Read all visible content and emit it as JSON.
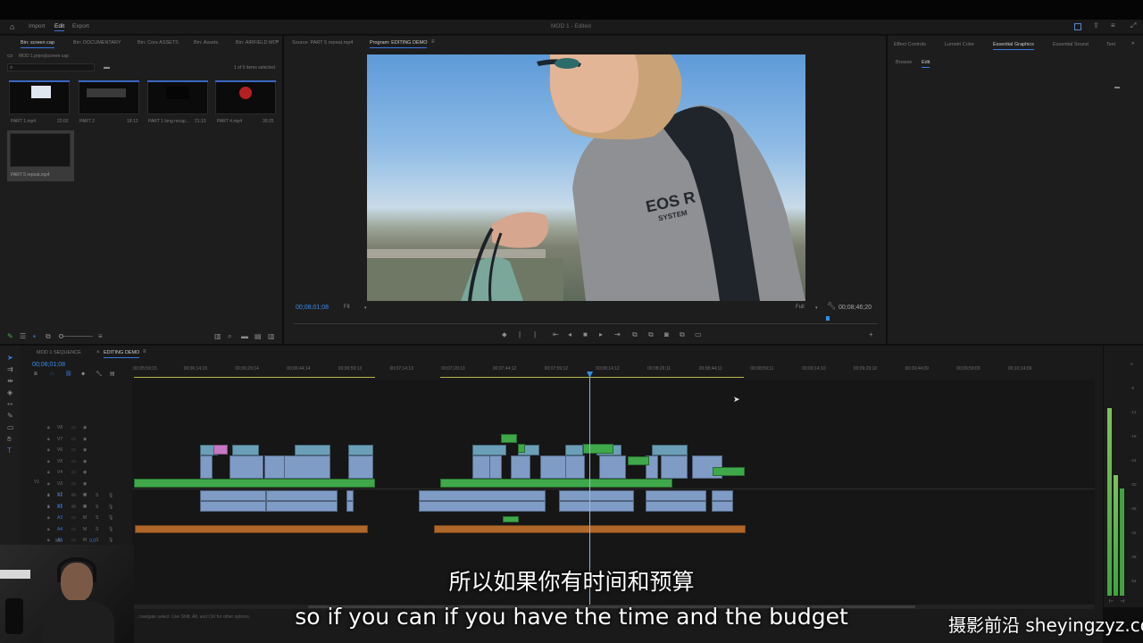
{
  "menu": {
    "home_icon": "home-icon",
    "items": [
      "Import",
      "Edit",
      "Export"
    ],
    "project_title": "MOD 1 - Edited"
  },
  "project_panel": {
    "tabs": [
      "Bin: screen cap",
      "Bin: DOCUMENTARY",
      "Bin: Core ASSETS",
      "Bin: Assets",
      "Bin: AIRFIELD MO"
    ],
    "path": "MOD 1.prproj\\screen cap",
    "items_selected": "1 of 5 items selected",
    "clips": [
      {
        "name": "PART 1.mp4",
        "duration": "22:02"
      },
      {
        "name": "PART 2",
        "duration": "18:12"
      },
      {
        "name": "PART 1 long recap...",
        "duration": "21:13"
      },
      {
        "name": "PART 4.mp4",
        "duration": "30:25"
      },
      {
        "name": "PART 5 repeat.mp4",
        "duration": "6:22"
      }
    ]
  },
  "source_tabs": {
    "source": "Source: PART 5 repeat.mp4",
    "program": "Program: EDITING DEMO"
  },
  "program_monitor": {
    "timecode": "00;08;01;08",
    "fit": "Fit",
    "quality": "Full",
    "duration": "00;08;46;20",
    "jacket_text_1": "EOS R",
    "jacket_text_2": "SYSTEM"
  },
  "right_panel": {
    "tabs": [
      "Effect Controls",
      "Lumetri Color",
      "Essential Graphics",
      "Essential Sound",
      "Text"
    ],
    "subtabs": [
      "Browse",
      "Edit"
    ]
  },
  "timeline": {
    "tabs": [
      "MOD 1 SEQUENCE",
      "EDITING DEMO"
    ],
    "timecode": "00;08;01;08",
    "ruler": [
      ";00;05;59;15",
      "00;06;14;15",
      "00;06;29;14",
      "00;06;44;14",
      "00;06;59;13",
      "00;07;14;13",
      "00;07;29;13",
      "00;07;44;12",
      "00;07;59;12",
      "00;08;14;12",
      "00;08;29;11",
      "00;08;44;11",
      "00;08;59;11",
      "00;09;14;10",
      "00;09;29;10",
      "00;09;44;09",
      "00;09;59;09",
      "00;10;14;09"
    ],
    "video_tracks": [
      "V8",
      "V7",
      "V6",
      "V5",
      "V4",
      "V3",
      "V2",
      "V1"
    ],
    "audio_tracks": [
      "A1",
      "A2",
      "A3",
      "A4",
      "A5"
    ],
    "mix_label": "Mix",
    "mix_value": "0.0",
    "status": "...navigate select. Use Shift, Alt, and Ctrl for other options."
  },
  "meter": {
    "scale": [
      "0",
      "-6",
      "-12",
      "-18",
      "-24",
      "-30",
      "-36",
      "-42",
      "-48",
      "-54"
    ]
  },
  "subtitles": {
    "chinese": "所以如果你有时间和预算",
    "english": "so if you can if you have the time and the budget"
  },
  "watermark": {
    "text": "摄影前沿 sheyingzyz.com"
  },
  "colors": {
    "accent_blue": "#3a78e0",
    "clip_blue": "#7f9cc6",
    "clip_green": "#3fa84a",
    "clip_pink": "#c877c5",
    "clip_orange": "#b0672a",
    "playhead": "#2f8ee8"
  }
}
